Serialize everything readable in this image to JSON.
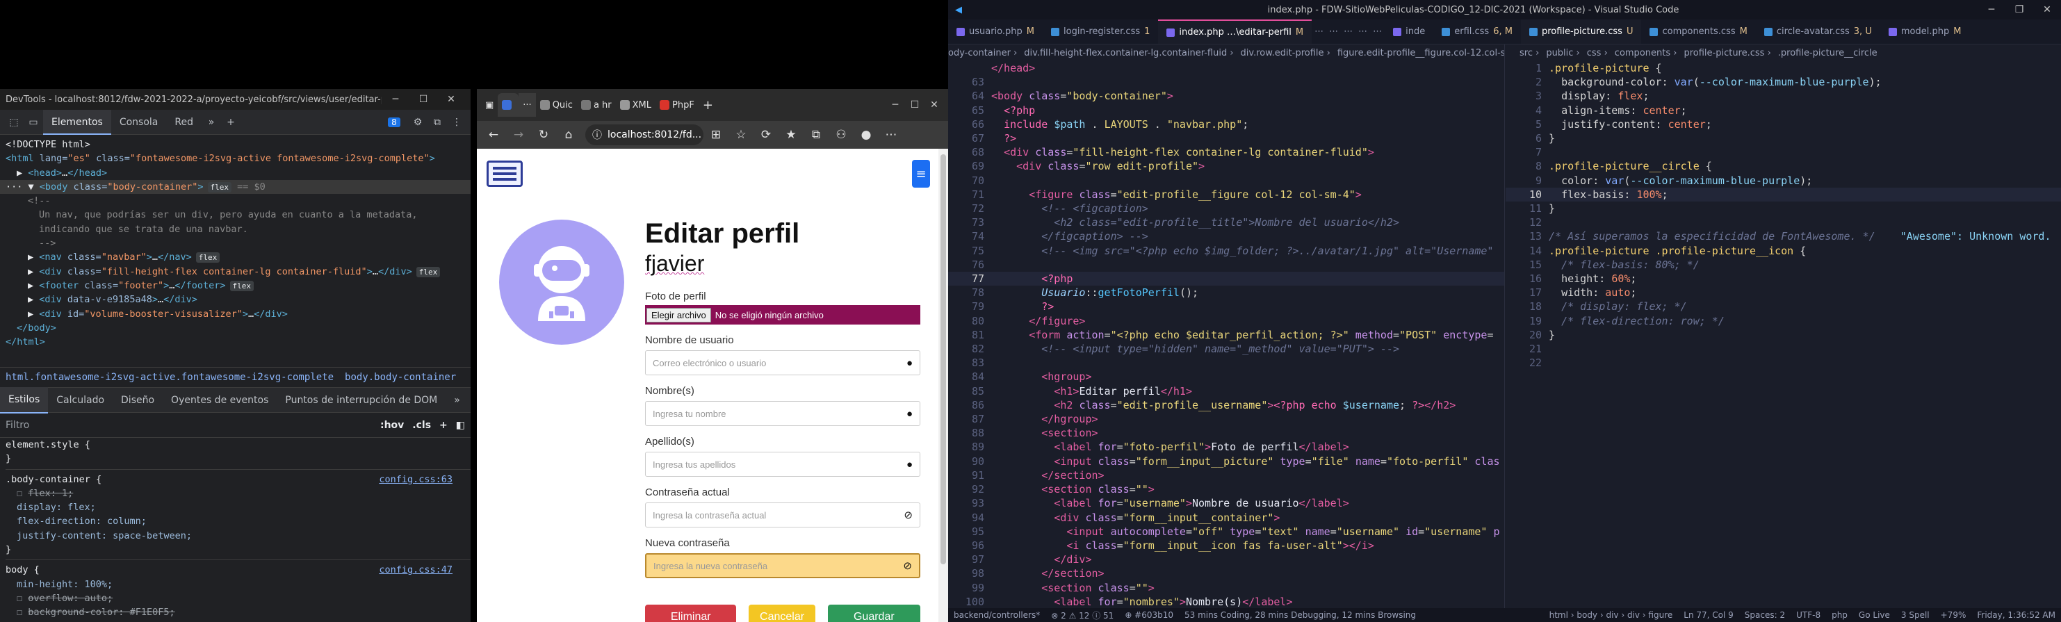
{
  "devtools": {
    "window_title": "DevTools - localhost:8012/fdw-2021-2022-a/proyecto-yeicobf/src/views/user/editar-perfil/index...",
    "tabs": [
      "Elementos",
      "Consola",
      "Red"
    ],
    "issues_count": "8",
    "dom_lines": [
      {
        "indent": 0,
        "parts": [
          [
            "t",
            "<!DOCTYPE html>"
          ]
        ]
      },
      {
        "indent": 0,
        "parts": [
          [
            "tag",
            "<html"
          ],
          [
            "attr",
            " lang="
          ],
          [
            "val",
            "\"es\""
          ],
          [
            "attr",
            " class="
          ],
          [
            "val",
            "\"fontawesome-i2svg-active fontawesome-i2svg-complete\""
          ],
          [
            "tag",
            ">"
          ]
        ]
      },
      {
        "indent": 1,
        "parts": [
          [
            "t",
            "▶ "
          ],
          [
            "tag",
            "<head>"
          ],
          [
            "t",
            "…"
          ],
          [
            "tag",
            "</head>"
          ]
        ]
      },
      {
        "indent": 0,
        "sel": true,
        "parts": [
          [
            "t",
            "··· ▼ "
          ],
          [
            "tag",
            "<body"
          ],
          [
            "attr",
            " class="
          ],
          [
            "val",
            "\"body-container\""
          ],
          [
            "tag",
            ">"
          ],
          [
            "badge",
            "flex"
          ],
          [
            "cm",
            " == $0"
          ]
        ]
      },
      {
        "indent": 2,
        "parts": [
          [
            "cm",
            "<!--"
          ]
        ]
      },
      {
        "indent": 3,
        "parts": [
          [
            "cm",
            "Un nav, que podrías ser un div, pero ayuda en cuanto a la metadata,"
          ]
        ]
      },
      {
        "indent": 3,
        "parts": [
          [
            "cm",
            "indicando que se trata de una navbar."
          ]
        ]
      },
      {
        "indent": 3,
        "parts": [
          [
            "cm",
            "-->"
          ]
        ]
      },
      {
        "indent": 2,
        "parts": [
          [
            "t",
            "▶ "
          ],
          [
            "tag",
            "<nav"
          ],
          [
            "attr",
            " class="
          ],
          [
            "val",
            "\"navbar\""
          ],
          [
            "tag",
            ">"
          ],
          [
            "t",
            "…"
          ],
          [
            "tag",
            "</nav>"
          ],
          [
            "badge",
            "flex"
          ]
        ]
      },
      {
        "indent": 2,
        "parts": [
          [
            "t",
            "▶ "
          ],
          [
            "tag",
            "<div"
          ],
          [
            "attr",
            " class="
          ],
          [
            "val",
            "\"fill-height-flex container-lg container-fluid\""
          ],
          [
            "tag",
            ">"
          ],
          [
            "t",
            "…"
          ],
          [
            "tag",
            "</div>"
          ],
          [
            "badge",
            "flex"
          ]
        ]
      },
      {
        "indent": 2,
        "parts": [
          [
            "t",
            "▶ "
          ],
          [
            "tag",
            "<footer"
          ],
          [
            "attr",
            " class="
          ],
          [
            "val",
            "\"footer\""
          ],
          [
            "tag",
            ">"
          ],
          [
            "t",
            "…"
          ],
          [
            "tag",
            "</footer>"
          ],
          [
            "badge",
            "flex"
          ]
        ]
      },
      {
        "indent": 2,
        "parts": [
          [
            "t",
            "▶ "
          ],
          [
            "tag",
            "<div"
          ],
          [
            "attr",
            " data-v-e9185a48"
          ],
          [
            "tag",
            ">"
          ],
          [
            "t",
            "…"
          ],
          [
            "tag",
            "</div>"
          ]
        ]
      },
      {
        "indent": 2,
        "parts": [
          [
            "t",
            "▶ "
          ],
          [
            "tag",
            "<div"
          ],
          [
            "attr",
            " id="
          ],
          [
            "val",
            "\"volume-booster-visusalizer\""
          ],
          [
            "tag",
            ">"
          ],
          [
            "t",
            "…"
          ],
          [
            "tag",
            "</div>"
          ]
        ]
      },
      {
        "indent": 1,
        "parts": [
          [
            "tag",
            "</body>"
          ]
        ]
      },
      {
        "indent": 0,
        "parts": [
          [
            "tag",
            "</html>"
          ]
        ]
      }
    ],
    "breadcrumbs": [
      "html.fontawesome-i2svg-active.fontawesome-i2svg-complete",
      "body.body-container"
    ],
    "style_tabs": [
      "Estilos",
      "Calculado",
      "Diseño",
      "Oyentes de eventos",
      "Puntos de interrupción de DOM"
    ],
    "filter_placeholder": "Filtro",
    "filter_hov": ":hov",
    "filter_cls": ".cls",
    "styles": [
      {
        "text": "element.style {",
        "kind": "sel"
      },
      {
        "text": "}",
        "kind": "sel"
      },
      {
        "text": ".body-container {",
        "kind": "sel",
        "link": "config.css:63"
      },
      {
        "text": "flex: 1;",
        "kind": "strike"
      },
      {
        "text": "display: flex;",
        "kind": "prop"
      },
      {
        "text": "flex-direction: column;",
        "kind": "prop"
      },
      {
        "text": "justify-content: space-between;",
        "kind": "prop"
      },
      {
        "text": "}",
        "kind": "sel"
      },
      {
        "text": "body {",
        "kind": "sel",
        "link": "config.css:47"
      },
      {
        "text": "min-height: 100%;",
        "kind": "prop"
      },
      {
        "text": "overflow: auto;",
        "kind": "strike"
      },
      {
        "text": "background-color: #F1E0F5;",
        "kind": "strike"
      }
    ]
  },
  "browser": {
    "tabs": [
      {
        "label": "",
        "color": "#3c6fd8"
      },
      {
        "label": "Quic",
        "color": "#8a8a8a"
      },
      {
        "label": "a hr",
        "color": "#777"
      },
      {
        "label": "XML",
        "color": "#999"
      },
      {
        "label": "PhpF",
        "color": "#d9342b"
      }
    ],
    "address": "localhost:8012/fd...",
    "page": {
      "title": "Editar perfil",
      "username": "fjavier",
      "photo_label": "Foto de perfil",
      "file_button": "Elegir archivo",
      "file_status": "No se eligió ningún archivo",
      "fields": [
        {
          "label": "Nombre de usuario",
          "placeholder": "Correo electrónico o usuario",
          "icon": "user-icon"
        },
        {
          "label": "Nombre(s)",
          "placeholder": "Ingresa tu nombre",
          "icon": "user-icon"
        },
        {
          "label": "Apellido(s)",
          "placeholder": "Ingresa tus apellidos",
          "icon": "user-icon"
        },
        {
          "label": "Contraseña actual",
          "placeholder": "Ingresa la contraseña actual",
          "icon": "eye-slash-icon"
        },
        {
          "label": "Nueva contraseña",
          "placeholder": "Ingresa la nueva contraseña",
          "icon": "eye-slash-icon"
        }
      ],
      "buttons": [
        {
          "label": "Eliminar",
          "color": "#d33a44"
        },
        {
          "label": "Cancelar",
          "color": "#f3c623"
        },
        {
          "label": "Guardar",
          "color": "#2e9a5a"
        }
      ]
    }
  },
  "vscode": {
    "title": "index.php - FDW-SitioWebPeliculas-CODIGO_12-DIC-2021 (Workspace) - Visual Studio Code",
    "tabs": [
      {
        "label": "usuario.php",
        "mark": "M",
        "color": "#7b68ee"
      },
      {
        "label": "login-register.css",
        "mark": "1",
        "color": "#3d8fd6"
      },
      {
        "label": "index.php …\\editar-perfil",
        "mark": "M",
        "color": "#7b68ee",
        "active": true
      },
      {
        "label": "inde",
        "mark": "",
        "color": "#7b68ee"
      },
      {
        "label": "erfil.css",
        "mark": "6, M",
        "color": "#3d8fd6"
      },
      {
        "label": "profile-picture.css",
        "mark": "U",
        "color": "#3d8fd6",
        "active2": true
      },
      {
        "label": "components.css",
        "mark": "M",
        "color": "#3d8fd6"
      },
      {
        "label": "circle-avatar.css",
        "mark": "3, U",
        "color": "#3d8fd6"
      },
      {
        "label": "model.php",
        "mark": "M",
        "color": "#7b68ee"
      }
    ],
    "left_breadcrumb": [
      "ody-container",
      "div.fill-height-flex.container-lg.container-fluid",
      "div.row.edit-profile",
      "figure.edit-profile__figure.col-12.col-sm-4"
    ],
    "right_breadcrumb": [
      "src",
      "public",
      "css",
      "components",
      "profile-picture.css",
      ".profile-picture__circle"
    ],
    "left_code": [
      {
        "n": "",
        "html": "<span class='c-tag'>&lt;/head&gt;</span>"
      },
      {
        "n": "63",
        "html": ""
      },
      {
        "n": "64",
        "html": "<span class='c-tag'>&lt;body</span> <span class='c-at'>class</span>=<span class='c-str'>\"body-container\"</span><span class='c-tag'>&gt;</span>"
      },
      {
        "n": "65",
        "html": "  <span class='c-kw'>&lt;?php</span>"
      },
      {
        "n": "66",
        "html": "  <span class='c-kw'>include</span> <span class='c-var'>$path</span> . <span class='c-php'>LAYOUTS</span> . <span class='c-str'>\"navbar.php\"</span>;"
      },
      {
        "n": "67",
        "html": "  <span class='c-kw'>?&gt;</span>"
      },
      {
        "n": "68",
        "html": "  <span class='c-tag'>&lt;div</span> <span class='c-at'>class</span>=<span class='c-str'>\"fill-height-flex container-lg container-fluid\"</span><span class='c-tag'>&gt;</span>"
      },
      {
        "n": "69",
        "html": "    <span class='c-tag'>&lt;div</span> <span class='c-at'>class</span>=<span class='c-str'>\"row edit-profile\"</span><span class='c-tag'>&gt;</span>"
      },
      {
        "n": "70",
        "html": ""
      },
      {
        "n": "71",
        "html": "      <span class='c-tag'>&lt;figure</span> <span class='c-at'>class</span>=<span class='c-str'>\"edit-profile__figure col-12 col-sm-4\"</span><span class='c-tag'>&gt;</span>"
      },
      {
        "n": "72",
        "html": "        <span class='c-cm'>&lt;!-- &lt;figcaption&gt;</span>"
      },
      {
        "n": "73",
        "html": "        <span class='c-cm'>  &lt;h2 class=\"edit-profile__title\"&gt;Nombre del usuario&lt;/h2&gt;</span>"
      },
      {
        "n": "74",
        "html": "        <span class='c-cm'>&lt;/figcaption&gt; --&gt;</span>"
      },
      {
        "n": "75",
        "html": "        <span class='c-cm'>&lt;!-- &lt;img src=\"&lt;?php echo $img_folder; ?&gt;../avatar/1.jpg\" alt=\"Username\"</span>"
      },
      {
        "n": "76",
        "html": ""
      },
      {
        "n": "77",
        "html": "        <span class='c-kw'>&lt;?php</span>",
        "cur": true
      },
      {
        "n": "78",
        "html": "        <span class='c-cls'>Usuario</span>::<span class='c-fn'>getFotoPerfil</span>();"
      },
      {
        "n": "79",
        "html": "        <span class='c-kw'>?&gt;</span>"
      },
      {
        "n": "80",
        "html": "      <span class='c-tag'>&lt;/figure&gt;</span>"
      },
      {
        "n": "81",
        "html": "      <span class='c-tag'>&lt;form</span> <span class='c-at'>action</span>=<span class='c-str'>\"&lt;?php echo $editar_perfil_action; ?&gt;\"</span> <span class='c-at'>method</span>=<span class='c-str'>\"POST\"</span> <span class='c-at'>enctype</span>="
      },
      {
        "n": "82",
        "html": "        <span class='c-cm'>&lt;!-- &lt;input type=\"hidden\" name=\"_method\" value=\"PUT\"&gt; --&gt;</span>"
      },
      {
        "n": "83",
        "html": ""
      },
      {
        "n": "84",
        "html": "        <span class='c-tag'>&lt;hgroup&gt;</span>"
      },
      {
        "n": "85",
        "html": "          <span class='c-tag'>&lt;h1&gt;</span><span class='c-txt'>Editar perfil</span><span class='c-tag'>&lt;/h1&gt;</span>"
      },
      {
        "n": "86",
        "html": "          <span class='c-tag'>&lt;h2</span> <span class='c-at'>class</span>=<span class='c-str'>\"edit-profile__username\"</span><span class='c-tag'>&gt;</span><span class='c-kw'>&lt;?php</span> <span class='c-kw'>echo</span> <span class='c-var'>$username</span>; <span class='c-kw'>?&gt;</span><span class='c-tag'>&lt;/h2&gt;</span>"
      },
      {
        "n": "87",
        "html": "        <span class='c-tag'>&lt;/hgroup&gt;</span>"
      },
      {
        "n": "88",
        "html": "        <span class='c-tag'>&lt;section&gt;</span>"
      },
      {
        "n": "89",
        "html": "          <span class='c-tag'>&lt;label</span> <span class='c-at'>for</span>=<span class='c-str'>\"foto-perfil\"</span><span class='c-tag'>&gt;</span><span class='c-txt'>Foto de perfil</span><span class='c-tag'>&lt;/label&gt;</span>"
      },
      {
        "n": "90",
        "html": "          <span class='c-tag'>&lt;input</span> <span class='c-at'>class</span>=<span class='c-str'>\"form__input__picture\"</span> <span class='c-at'>type</span>=<span class='c-str'>\"file\"</span> <span class='c-at'>name</span>=<span class='c-str'>\"foto-perfil\"</span> <span class='c-at'>clas</span>"
      },
      {
        "n": "91",
        "html": "        <span class='c-tag'>&lt;/section&gt;</span>"
      },
      {
        "n": "92",
        "html": "        <span class='c-tag'>&lt;section</span> <span class='c-at'>class</span>=<span class='c-str'>\"\"</span><span class='c-tag'>&gt;</span>"
      },
      {
        "n": "93",
        "html": "          <span class='c-tag'>&lt;label</span> <span class='c-at'>for</span>=<span class='c-str'>\"username\"</span><span class='c-tag'>&gt;</span><span class='c-txt'>Nombre de usuario</span><span class='c-tag'>&lt;/label&gt;</span>"
      },
      {
        "n": "94",
        "html": "          <span class='c-tag'>&lt;div</span> <span class='c-at'>class</span>=<span class='c-str'>\"form__input__container\"</span><span class='c-tag'>&gt;</span>"
      },
      {
        "n": "95",
        "html": "            <span class='c-tag'>&lt;input</span> <span class='c-at'>autocomplete</span>=<span class='c-str'>\"off\"</span> <span class='c-at'>type</span>=<span class='c-str'>\"text\"</span> <span class='c-at'>name</span>=<span class='c-str'>\"username\"</span> <span class='c-at'>id</span>=<span class='c-str'>\"username\"</span> <span class='c-at'>p</span>"
      },
      {
        "n": "96",
        "html": "            <span class='c-tag'>&lt;i</span> <span class='c-at'>class</span>=<span class='c-str'>\"form__input__icon fas fa-user-alt\"</span><span class='c-tag'>&gt;&lt;/i&gt;</span>"
      },
      {
        "n": "97",
        "html": "          <span class='c-tag'>&lt;/div&gt;</span>"
      },
      {
        "n": "98",
        "html": "        <span class='c-tag'>&lt;/section&gt;</span>"
      },
      {
        "n": "99",
        "html": "        <span class='c-tag'>&lt;section</span> <span class='c-at'>class</span>=<span class='c-str'>\"\"</span><span class='c-tag'>&gt;</span>"
      },
      {
        "n": "100",
        "html": "          <span class='c-tag'>&lt;label</span> <span class='c-at'>for</span>=<span class='c-str'>\"nombres\"</span><span class='c-tag'>&gt;</span><span class='c-txt'>Nombre(s)</span><span class='c-tag'>&lt;/label&gt;</span>"
      },
      {
        "n": "101",
        "html": "          <span class='c-tag'>&lt;div</span> <span class='c-at'>class</span>=<span class='c-str'>\"form__input__container\"</span><span class='c-tag'>&gt;</span>"
      }
    ],
    "right_code": [
      {
        "n": "1",
        "html": "<span class='c-sel'>.profile-picture</span> {"
      },
      {
        "n": "2",
        "html": "  <span class='c-prop'>background-color</span>: <span class='c-fnv'>var</span>(<span class='c-var'>--color-maximum-blue-purple</span>);"
      },
      {
        "n": "3",
        "html": "  <span class='c-prop'>display</span>: <span class='c-val'>flex</span>;"
      },
      {
        "n": "4",
        "html": "  <span class='c-prop'>align-items</span>: <span class='c-val'>center</span>;"
      },
      {
        "n": "5",
        "html": "  <span class='c-prop'>justify-content</span>: <span class='c-val'>center</span>;"
      },
      {
        "n": "6",
        "html": "}"
      },
      {
        "n": "7",
        "html": ""
      },
      {
        "n": "8",
        "html": "<span class='c-sel'>.profile-picture__circle</span> {"
      },
      {
        "n": "9",
        "html": "  <span class='c-prop'>color</span>: <span class='c-fnv'>var</span>(<span class='c-var'>--color-maximum-blue-purple</span>);"
      },
      {
        "n": "10",
        "html": "  <span class='c-prop'>flex-basis</span>: <span class='c-val'>100%</span>;",
        "cur": true
      },
      {
        "n": "11",
        "html": "}"
      },
      {
        "n": "12",
        "html": ""
      },
      {
        "n": "13",
        "html": "<span class='c-cm'>/* Así superamos la especificidad de FontAwesome. */</span>    <span class='c-var'>\"Awesome\": Unknown word.</span>"
      },
      {
        "n": "14",
        "html": "<span class='c-sel'>.profile-picture .profile-picture__icon</span> {"
      },
      {
        "n": "15",
        "html": "  <span class='c-cm'>/* flex-basis: 80%; */</span>"
      },
      {
        "n": "16",
        "html": "  <span class='c-prop'>height</span>: <span class='c-val'>60%</span>;"
      },
      {
        "n": "17",
        "html": "  <span class='c-prop'>width</span>: <span class='c-val'>auto</span>;"
      },
      {
        "n": "18",
        "html": "  <span class='c-cm'>/* display: flex; */</span>"
      },
      {
        "n": "19",
        "html": "  <span class='c-cm'>/* flex-direction: row; */</span>"
      },
      {
        "n": "20",
        "html": "}"
      },
      {
        "n": "21",
        "html": ""
      },
      {
        "n": "22",
        "html": ""
      }
    ],
    "status": [
      "backend/controllers*",
      "⊗ 2 ⚠ 12 ⓘ 51",
      "⊕ #603b10",
      "53 mins Coding, 28 mins Debugging, 12 mins Browsing",
      "html › body › div › div › figure",
      "Ln 77, Col 9",
      "Spaces: 2",
      "UTF-8",
      "php",
      "Go Live",
      "3 Spell",
      "+79%",
      "Friday, 1:36:52 AM"
    ]
  }
}
